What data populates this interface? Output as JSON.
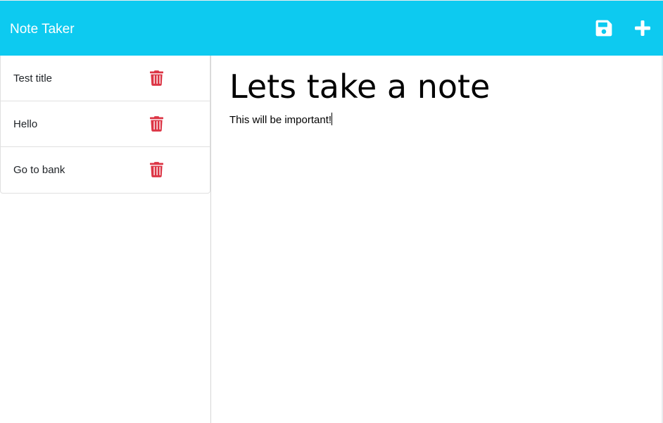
{
  "app": {
    "title": "Note Taker"
  },
  "toolbar": {
    "save_icon": "save-icon",
    "add_icon": "plus-icon"
  },
  "notes": [
    {
      "title": "Test title",
      "delete_icon": "trash-icon"
    },
    {
      "title": "Hello",
      "delete_icon": "trash-icon"
    },
    {
      "title": "Go to bank",
      "delete_icon": "trash-icon"
    }
  ],
  "active_note": {
    "title": "Lets take a note",
    "text": "This will be important!"
  },
  "colors": {
    "navbar": "#0dcaf0",
    "delete": "#dc3545",
    "text": "#212529"
  }
}
